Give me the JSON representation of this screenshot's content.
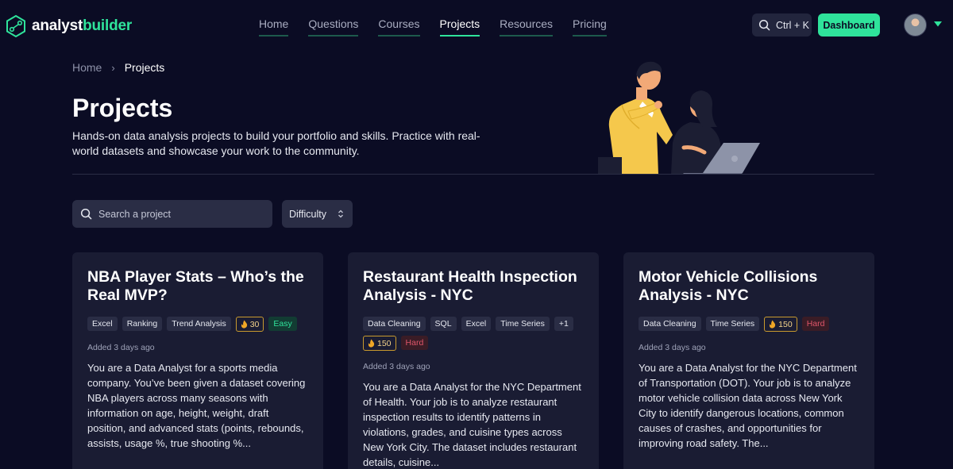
{
  "brand": {
    "name_prefix": "analyst",
    "name_suffix": "builder",
    "accent": "#2fe39b"
  },
  "nav": {
    "items": [
      {
        "label": "Home",
        "active": false
      },
      {
        "label": "Questions",
        "active": false
      },
      {
        "label": "Courses",
        "active": false
      },
      {
        "label": "Projects",
        "active": true
      },
      {
        "label": "Resources",
        "active": false
      },
      {
        "label": "Pricing",
        "active": false
      }
    ],
    "search_shortcut": "Ctrl + K",
    "dashboard_label": "Dashboard"
  },
  "breadcrumb": {
    "home": "Home",
    "separator": "›",
    "current": "Projects"
  },
  "hero": {
    "title": "Projects",
    "description": "Hands-on data analysis projects to build your portfolio and skills. Practice with real-world datasets and showcase your work to the community."
  },
  "filters": {
    "search_placeholder": "Search a project",
    "difficulty_label": "Difficulty"
  },
  "cards": [
    {
      "title": "NBA Player Stats – Who’s the Real MVP?",
      "tags": [
        "Excel",
        "Ranking",
        "Trend Analysis"
      ],
      "xp": "30",
      "difficulty": "Easy",
      "added": "Added 3 days ago",
      "description": "You are a Data Analyst for a sports media company. You’ve been given a dataset covering NBA players across many seasons with information on age, height, weight, draft position, and advanced stats (points, rebounds, assists, usage %, true shooting %..."
    },
    {
      "title": "Restaurant Health Inspection Analysis - NYC",
      "tags": [
        "Data Cleaning",
        "SQL",
        "Excel",
        "Time Series",
        "+1"
      ],
      "xp": "150",
      "difficulty": "Hard",
      "added": "Added 3 days ago",
      "description": "You are a Data Analyst for the NYC Department of Health. Your job is to analyze restaurant inspection results to identify patterns in violations, grades, and cuisine types across New York City. The dataset includes restaurant details, cuisine..."
    },
    {
      "title": "Motor Vehicle Collisions Analysis - NYC",
      "tags": [
        "Data Cleaning",
        "Time Series"
      ],
      "xp": "150",
      "difficulty": "Hard",
      "added": "Added 3 days ago",
      "description": "You are a Data Analyst for the NYC Department of Transportation (DOT). Your job is to analyze motor vehicle collision data across New York City to identify dangerous locations, common causes of crashes, and opportunities for improving road safety. The..."
    }
  ]
}
